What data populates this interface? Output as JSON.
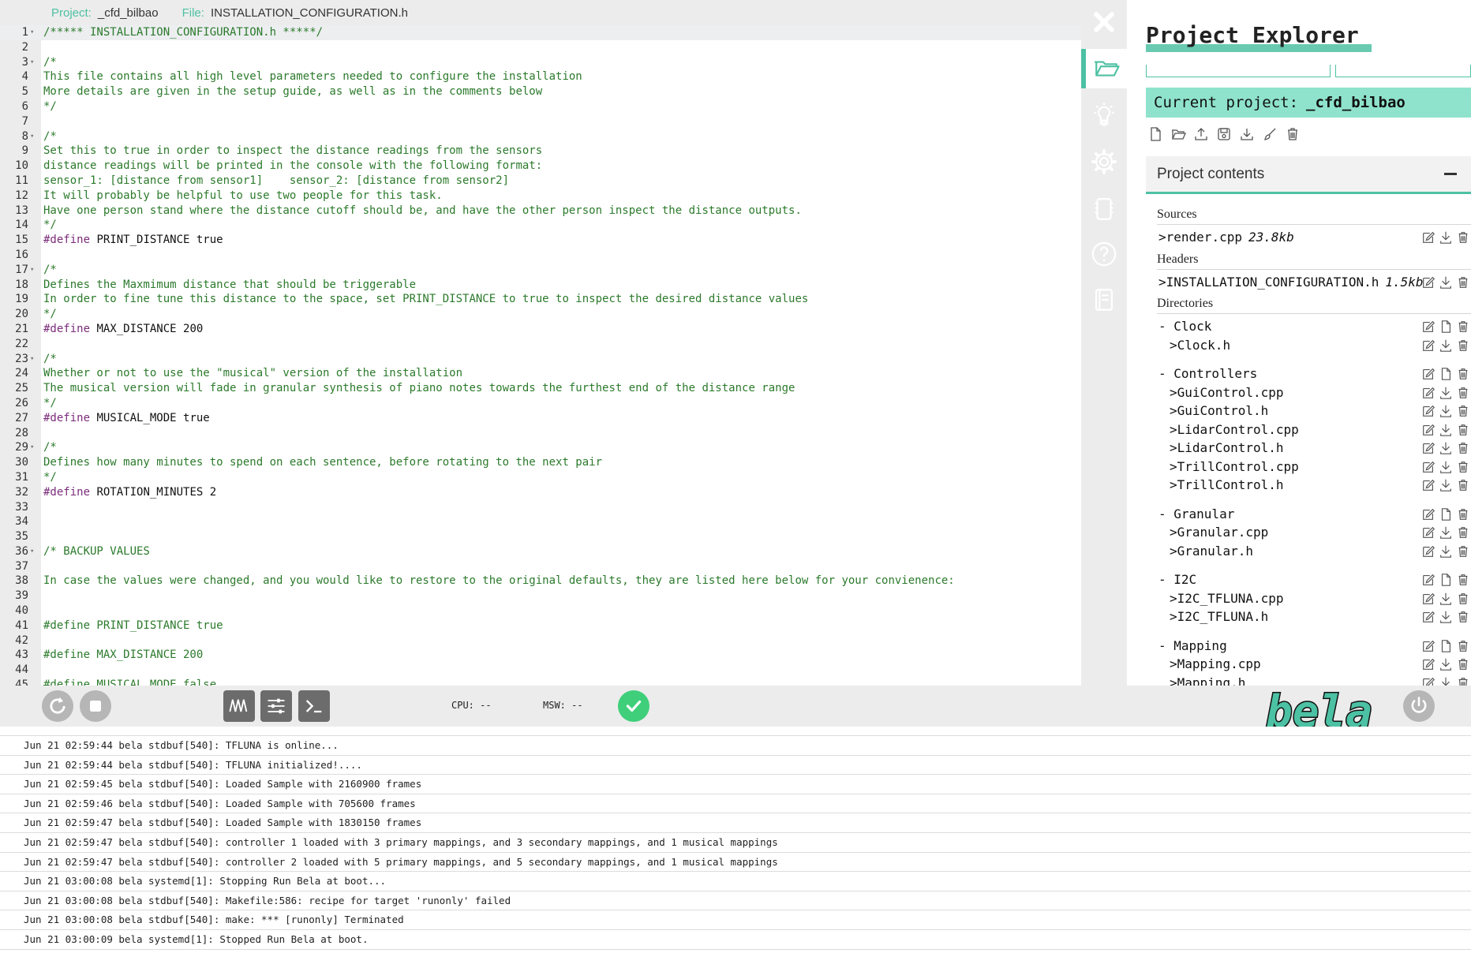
{
  "editor": {
    "project_label": "Project:",
    "project_name": "_cfd_bilbao",
    "file_label": "File:",
    "file_name": "INSTALLATION_CONFIGURATION.h",
    "lines": [
      {
        "n": "1",
        "fold": true,
        "text": "/***** INSTALLATION_CONFIGURATION.h *****/"
      },
      {
        "n": "2",
        "text": ""
      },
      {
        "n": "3",
        "fold": true,
        "text": "/*"
      },
      {
        "n": "4",
        "text": "This file contains all high level parameters needed to configure the installation"
      },
      {
        "n": "5",
        "text": "More details are given in the setup guide, as well as in the comments below"
      },
      {
        "n": "6",
        "text": "*/"
      },
      {
        "n": "7",
        "text": ""
      },
      {
        "n": "8",
        "fold": true,
        "text": "/*"
      },
      {
        "n": "9",
        "text": "Set this to true in order to inspect the distance readings from the sensors"
      },
      {
        "n": "10",
        "text": "distance readings will be printed in the console with the following format:"
      },
      {
        "n": "11",
        "text": "sensor_1: [distance from sensor1]    sensor_2: [distance from sensor2]"
      },
      {
        "n": "12",
        "text": "It will probably be helpful to use two people for this task."
      },
      {
        "n": "13",
        "text": "Have one person stand where the distance cutoff should be, and have the other person inspect the distance outputs."
      },
      {
        "n": "14",
        "text": "*/"
      },
      {
        "n": "15",
        "kw": "#define",
        "rest": " PRINT_DISTANCE true"
      },
      {
        "n": "16",
        "text": ""
      },
      {
        "n": "17",
        "fold": true,
        "text": "/*"
      },
      {
        "n": "18",
        "text": "Defines the Maxmimum distance that should be triggerable"
      },
      {
        "n": "19",
        "text": "In order to fine tune this distance to the space, set PRINT_DISTANCE to true to inspect the desired distance values"
      },
      {
        "n": "20",
        "text": "*/"
      },
      {
        "n": "21",
        "kw": "#define",
        "rest": " MAX_DISTANCE 200"
      },
      {
        "n": "22",
        "text": ""
      },
      {
        "n": "23",
        "fold": true,
        "text": "/*"
      },
      {
        "n": "24",
        "text": "Whether or not to use the \"musical\" version of the installation"
      },
      {
        "n": "25",
        "text": "The musical version will fade in granular synthesis of piano notes towards the furthest end of the distance range"
      },
      {
        "n": "26",
        "text": "*/"
      },
      {
        "n": "27",
        "kw": "#define",
        "rest": " MUSICAL_MODE true"
      },
      {
        "n": "28",
        "text": ""
      },
      {
        "n": "29",
        "fold": true,
        "text": "/*"
      },
      {
        "n": "30",
        "text": "Defines how many minutes to spend on each sentence, before rotating to the next pair"
      },
      {
        "n": "31",
        "text": "*/"
      },
      {
        "n": "32",
        "kw": "#define",
        "rest": " ROTATION_MINUTES 2"
      },
      {
        "n": "33",
        "text": ""
      },
      {
        "n": "34",
        "text": ""
      },
      {
        "n": "35",
        "text": ""
      },
      {
        "n": "36",
        "fold": true,
        "text": "/* BACKUP VALUES"
      },
      {
        "n": "37",
        "text": ""
      },
      {
        "n": "38",
        "text": "In case the values were changed, and you would like to restore to the original defaults, they are listed here below for your convienence:"
      },
      {
        "n": "39",
        "text": ""
      },
      {
        "n": "40",
        "text": ""
      },
      {
        "n": "41",
        "text": "#define PRINT_DISTANCE true"
      },
      {
        "n": "42",
        "text": ""
      },
      {
        "n": "43",
        "text": "#define MAX_DISTANCE 200"
      },
      {
        "n": "44",
        "text": ""
      },
      {
        "n": "45",
        "text": "#define MUSICAL_MODE false"
      }
    ]
  },
  "tools": [
    {
      "name": "close-icon"
    },
    {
      "name": "folder-icon",
      "active": true
    },
    {
      "name": "lightbulb-icon"
    },
    {
      "name": "gear-icon"
    },
    {
      "name": "board-icon"
    },
    {
      "name": "help-icon"
    },
    {
      "name": "book-icon"
    }
  ],
  "explorer": {
    "title": "Project Explorer",
    "current_project_label": "Current project:",
    "current_project_name": "_cfd_bilbao",
    "contents_label": "Project contents",
    "sections": {
      "sources": "Sources",
      "headers": "Headers",
      "directories": "Directories"
    },
    "sources": [
      {
        "name": "render.cpp",
        "size": "23.8kb"
      }
    ],
    "headers": [
      {
        "name": "INSTALLATION_CONFIGURATION.h",
        "size": "1.5kb"
      }
    ],
    "directories": [
      {
        "name": "Clock",
        "files": [
          "Clock.h"
        ]
      },
      {
        "name": "Controllers",
        "files": [
          "GuiControl.cpp",
          "GuiControl.h",
          "LidarControl.cpp",
          "LidarControl.h",
          "TrillControl.cpp",
          "TrillControl.h"
        ]
      },
      {
        "name": "Granular",
        "files": [
          "Granular.cpp",
          "Granular.h"
        ]
      },
      {
        "name": "I2C",
        "files": [
          "I2C_TFLUNA.cpp",
          "I2C_TFLUNA.h"
        ]
      },
      {
        "name": "Mapping",
        "files": [
          "Mapping.cpp",
          "Mapping.h"
        ]
      }
    ]
  },
  "toolbar": {
    "cpu_label": "CPU: --",
    "msw_label": "MSW: --",
    "logo": "bela"
  },
  "console": {
    "lines": [
      "Jun 21 02:59:44 bela stdbuf[540]: TFLUNA is online...",
      "Jun 21 02:59:44 bela stdbuf[540]: TFLUNA initialized!....",
      "Jun 21 02:59:45 bela stdbuf[540]: Loaded Sample with 2160900 frames",
      "Jun 21 02:59:46 bela stdbuf[540]: Loaded Sample with 705600 frames",
      "Jun 21 02:59:47 bela stdbuf[540]: Loaded Sample with 1830150 frames",
      "Jun 21 02:59:47 bela stdbuf[540]: controller 1 loaded with 3 primary mappings, and 3 secondary mappings, and 1 musical mappings",
      "Jun 21 02:59:47 bela stdbuf[540]: controller 2 loaded with 5 primary mappings, and 5 secondary mappings, and 1 musical mappings",
      "Jun 21 03:00:08 bela systemd[1]: Stopping Run Bela at boot...",
      "Jun 21 03:00:08 bela stdbuf[540]: Makefile:586: recipe for target 'runonly' failed",
      "Jun 21 03:00:08 bela stdbuf[540]: make: *** [runonly] Terminated",
      "Jun 21 03:00:09 bela systemd[1]: Stopped Run Bela at boot."
    ]
  },
  "colors": {
    "accent": "#4cc1a3",
    "comment": "#2c7a2c",
    "keyword": "#7a2c7a",
    "ok": "#3fcf7a"
  }
}
